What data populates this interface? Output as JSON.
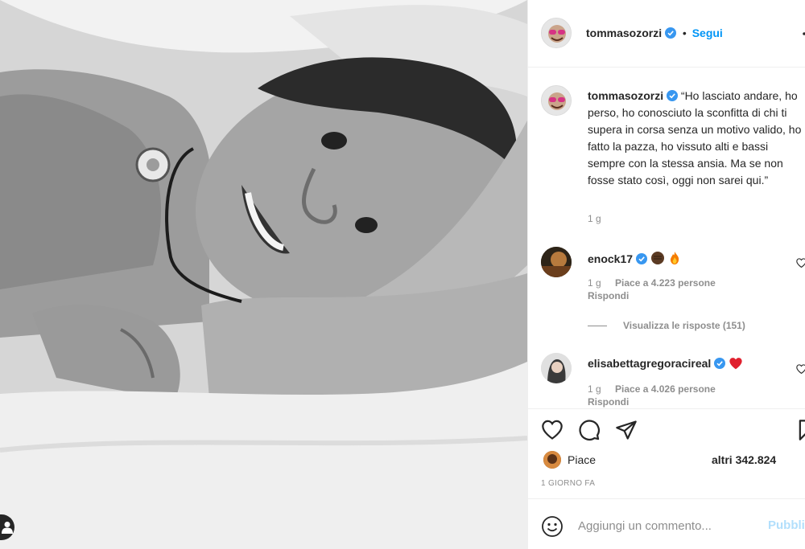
{
  "post": {
    "username": "tommasozorzi",
    "follow_label": "Segui",
    "dot": "•",
    "caption": "“Ho lasciato andare, ho perso, ho conosciuto la sconfitta di chi ti supera in corsa senza un motivo valido, ho fatto la pazza, ho vissuto alti e bassi sempre con la stessa ansia. Ma se non fosse stato così, oggi non sarei qui.”",
    "caption_time": "1 g",
    "likes_prefix": "Piace",
    "likes_count": "altri 342.824",
    "timestamp": "1 GIORNO FA"
  },
  "comments": [
    {
      "username": "enock17",
      "emoji": [
        "dark-fist-emoji",
        "fire-emoji"
      ],
      "time": "1 g",
      "likes": "Piace a 4.223 persone",
      "reply": "Rispondi",
      "view_replies": "Visualizza le risposte (151)"
    },
    {
      "username": "elisabettagregoraciреal",
      "emoji": [
        "red-heart-emoji"
      ],
      "time": "1 g",
      "likes": "Piace a 4.026 persone",
      "reply": "Rispondi"
    }
  ],
  "add_comment": {
    "placeholder": "Aggiungi un commento...",
    "publish": "Pubblica"
  },
  "colors": {
    "accent": "#0095f6",
    "verified": "#3897f0",
    "publish_disabled": "#b2dffc",
    "muted": "#8e8e8e",
    "heart": "#ed4956"
  }
}
